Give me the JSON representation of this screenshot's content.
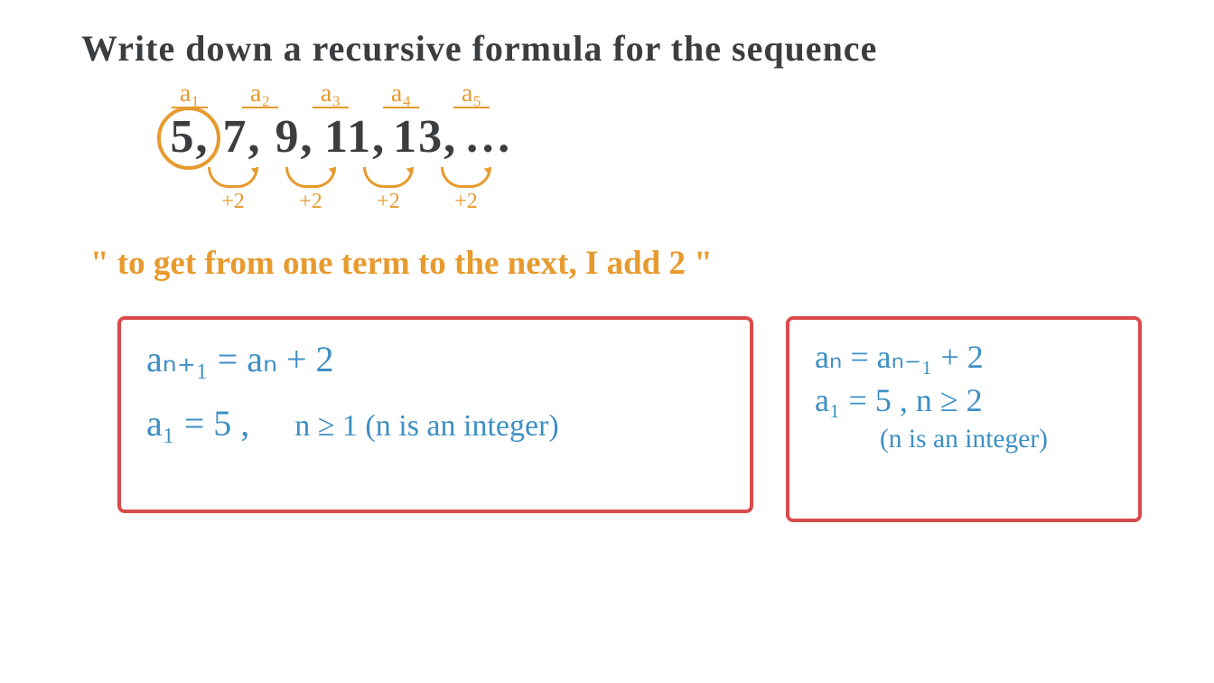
{
  "title": "Write down a recursive formula for the sequence",
  "terms": {
    "labels": [
      "a₁",
      "a₂",
      "a₃",
      "a₄",
      "a₅"
    ],
    "values": [
      "5,",
      "7,",
      "9,",
      "11,",
      "13,",
      "…"
    ],
    "increments": [
      "+2",
      "+2",
      "+2",
      "+2"
    ]
  },
  "rule_text": "\" to get from one term to the next, I add 2 \"",
  "box1": {
    "line1": "aₙ₊₁ = aₙ + 2",
    "line2a": "a₁ = 5 ,",
    "line2b": "n ≥ 1  (n is an integer)"
  },
  "box2": {
    "line1": "aₙ = aₙ₋₁ + 2",
    "line2": "a₁ = 5 , n ≥ 2",
    "line3": "(n is an integer)"
  }
}
